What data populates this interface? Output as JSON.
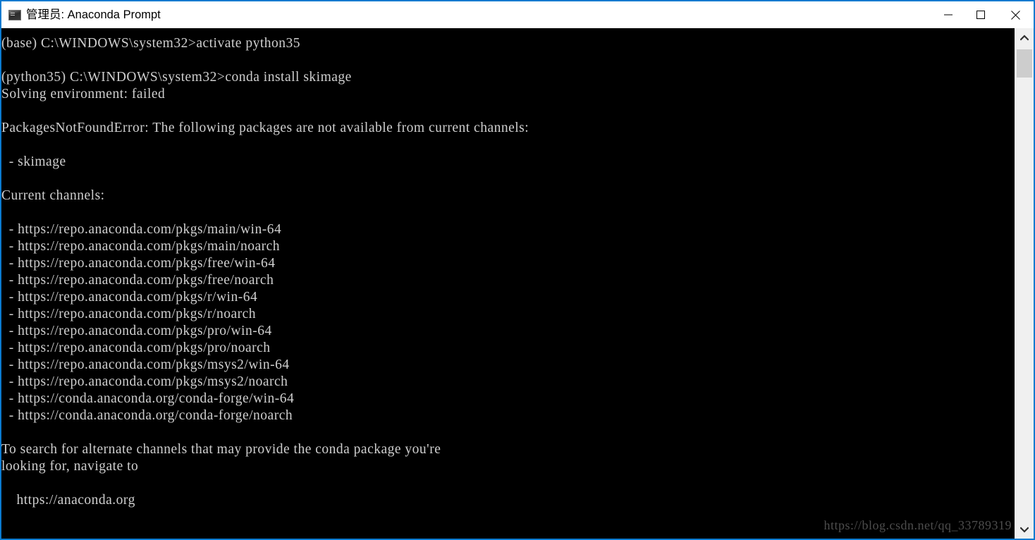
{
  "window": {
    "title": "管理员: Anaconda Prompt",
    "icon": "console-icon",
    "border_color": "#0a7ad0",
    "titlebar_bg": "#ffffff",
    "console_bg": "#000000",
    "console_fg": "#cfcfcf"
  },
  "controls": {
    "minimize_label": "—",
    "maximize_label": "▢",
    "close_label": "✕"
  },
  "scrollbar": {
    "up_arrow": "▲",
    "down_arrow": "▼",
    "thumb_color": "#cdcdcd",
    "track_color": "#f0f0f0"
  },
  "console": {
    "lines": [
      "(base) C:\\WINDOWS\\system32>activate python35",
      "",
      "(python35) C:\\WINDOWS\\system32>conda install skimage",
      "Solving environment: failed",
      "",
      "PackagesNotFoundError: The following packages are not available from current channels:",
      "",
      "  - skimage",
      "",
      "Current channels:",
      "",
      "  - https://repo.anaconda.com/pkgs/main/win-64",
      "  - https://repo.anaconda.com/pkgs/main/noarch",
      "  - https://repo.anaconda.com/pkgs/free/win-64",
      "  - https://repo.anaconda.com/pkgs/free/noarch",
      "  - https://repo.anaconda.com/pkgs/r/win-64",
      "  - https://repo.anaconda.com/pkgs/r/noarch",
      "  - https://repo.anaconda.com/pkgs/pro/win-64",
      "  - https://repo.anaconda.com/pkgs/pro/noarch",
      "  - https://repo.anaconda.com/pkgs/msys2/win-64",
      "  - https://repo.anaconda.com/pkgs/msys2/noarch",
      "  - https://conda.anaconda.org/conda-forge/win-64",
      "  - https://conda.anaconda.org/conda-forge/noarch",
      "",
      "To search for alternate channels that may provide the conda package you're",
      "looking for, navigate to",
      "",
      "    https://anaconda.org"
    ],
    "text": "(base) C:\\WINDOWS\\system32>activate python35\n\n(python35) C:\\WINDOWS\\system32>conda install skimage\nSolving environment: failed\n\nPackagesNotFoundError: The following packages are not available from current channels:\n\n  - skimage\n\nCurrent channels:\n\n  - https://repo.anaconda.com/pkgs/main/win-64\n  - https://repo.anaconda.com/pkgs/main/noarch\n  - https://repo.anaconda.com/pkgs/free/win-64\n  - https://repo.anaconda.com/pkgs/free/noarch\n  - https://repo.anaconda.com/pkgs/r/win-64\n  - https://repo.anaconda.com/pkgs/r/noarch\n  - https://repo.anaconda.com/pkgs/pro/win-64\n  - https://repo.anaconda.com/pkgs/pro/noarch\n  - https://repo.anaconda.com/pkgs/msys2/win-64\n  - https://repo.anaconda.com/pkgs/msys2/noarch\n  - https://conda.anaconda.org/conda-forge/win-64\n  - https://conda.anaconda.org/conda-forge/noarch\n\nTo search for alternate channels that may provide the conda package you're\nlooking for, navigate to\n\n    https://anaconda.org"
  },
  "watermark": {
    "text": "https://blog.csdn.net/qq_33789319"
  }
}
